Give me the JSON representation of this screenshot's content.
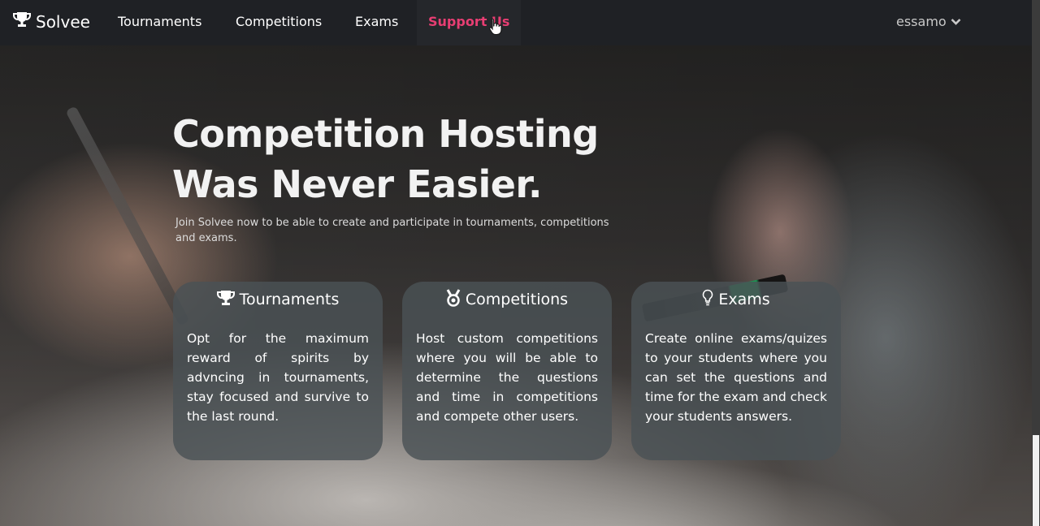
{
  "navbar": {
    "brand": "Solvee",
    "links": [
      "Tournaments",
      "Competitions",
      "Exams",
      "Support Us"
    ],
    "active_link": "Support Us",
    "user": "essamo",
    "accent_color": "#e83e73"
  },
  "hero": {
    "title_line1": "Competition Hosting",
    "title_line2": "Was Never Easier.",
    "subtitle": "Join Solvee now to be able to create and participate in tournaments, competitions and exams."
  },
  "cards": [
    {
      "icon": "trophy-icon",
      "title": "Tournaments",
      "body": "Opt for the maximum reward of spirits by advncing in tournaments, stay focused and survive to the last round."
    },
    {
      "icon": "medal-icon",
      "title": "Competitions",
      "body": "Host custom competitions where you will be able to determine the questions and time in competitions and compete other users."
    },
    {
      "icon": "lightbulb-icon",
      "title": "Exams",
      "body": "Create online exams/quizes to your students where you can set the questions and time for the exam and check your students answers."
    }
  ]
}
